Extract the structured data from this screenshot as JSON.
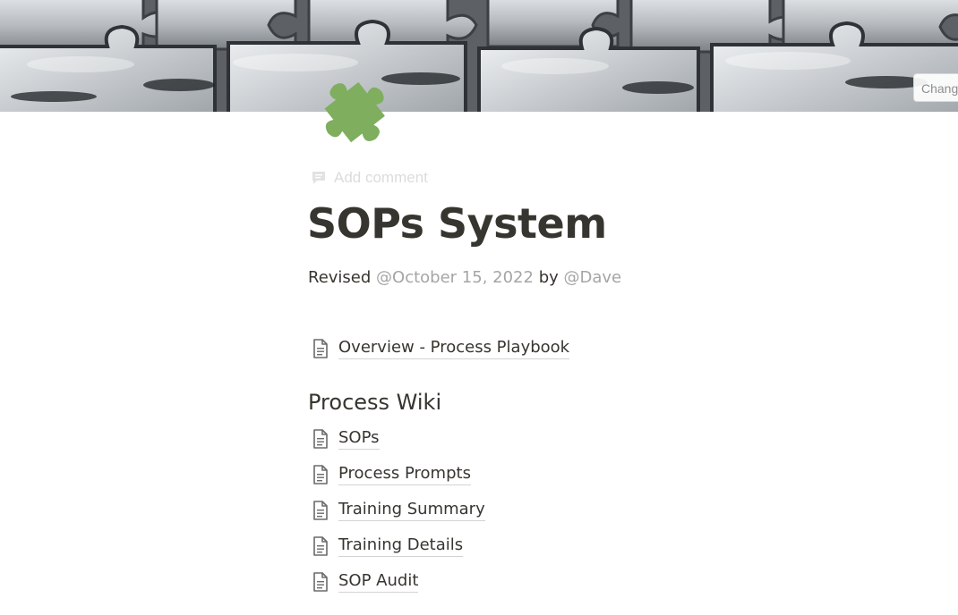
{
  "cover": {
    "change_cover_label": "Change cover",
    "image_subject": "grey puzzle pieces"
  },
  "page_icon": {
    "name": "puzzle-piece-icon",
    "color": "#7fae5e"
  },
  "comment": {
    "label": "Add comment",
    "icon": "comment-icon"
  },
  "title": "SOPs System",
  "revised": {
    "prefix": "Revised",
    "date_mention": "@October 15, 2022",
    "by": "by",
    "user_mention": "@Dave"
  },
  "links": {
    "overview": "Overview - Process Playbook"
  },
  "process_wiki": {
    "heading": "Process Wiki",
    "items": [
      {
        "label": "SOPs"
      },
      {
        "label": "Process Prompts"
      },
      {
        "label": "Training Summary"
      },
      {
        "label": "Training Details"
      },
      {
        "label": "SOP Audit"
      }
    ]
  },
  "colors": {
    "text": "#37352f",
    "mention": "#a5a5a5",
    "placeholder": "#dcdcdc",
    "icon_green": "#7fae5e"
  }
}
